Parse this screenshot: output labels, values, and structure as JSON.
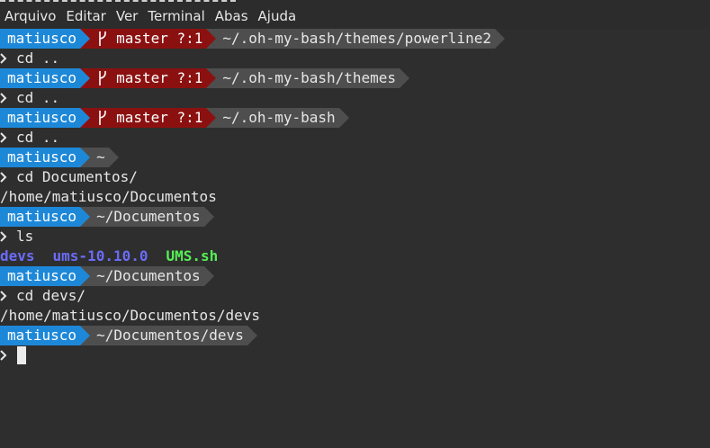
{
  "menu": [
    "Arquivo",
    "Editar",
    "Ver",
    "Terminal",
    "Abas",
    "Ajuda"
  ],
  "colors": {
    "user_segment": "#1e88d8",
    "git_segment": "#8b1111",
    "path_segment": "#4e4e4e",
    "background": "#2e2e2e",
    "ls_dir": "#6a6cf6",
    "ls_exec": "#55ee55"
  },
  "icons": {
    "branch": "git-branch-icon",
    "prompt": "chevron-right-icon"
  },
  "lines": [
    {
      "user": "matiusco",
      "git": "master ?:1",
      "path": "~/.oh-my-bash/themes/powerline2"
    },
    {
      "cmd": "cd .."
    },
    {
      "user": "matiusco",
      "git": "master ?:1",
      "path": "~/.oh-my-bash/themes"
    },
    {
      "cmd": "cd .."
    },
    {
      "user": "matiusco",
      "git": "master ?:1",
      "path": "~/.oh-my-bash"
    },
    {
      "cmd": "cd .."
    },
    {
      "user": "matiusco",
      "path": "~"
    },
    {
      "cmd": "cd Documentos/"
    },
    {
      "output": "/home/matiusco/Documentos"
    },
    {
      "user": "matiusco",
      "path": "~/Documentos"
    },
    {
      "cmd": "ls"
    },
    {
      "ls": [
        "devs",
        "ums-10.10.0",
        "UMS.sh"
      ]
    },
    {
      "user": "matiusco",
      "path": "~/Documentos"
    },
    {
      "cmd": "cd devs/"
    },
    {
      "output": "/home/matiusco/Documentos/devs"
    },
    {
      "user": "matiusco",
      "path": "~/Documentos/devs"
    },
    {
      "cmd": ""
    }
  ]
}
